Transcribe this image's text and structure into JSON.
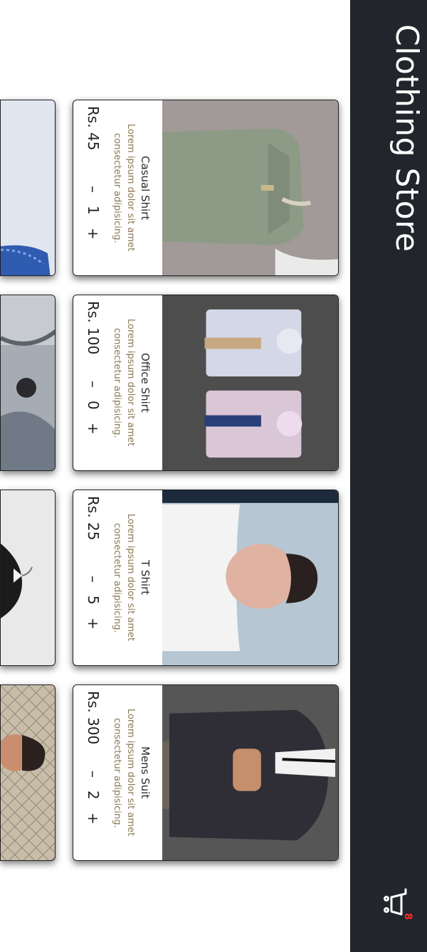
{
  "header": {
    "title": "Clothing Store",
    "cart_count": "8",
    "bg_color": "#22252b"
  },
  "products": [
    {
      "name": "Casual Shirt",
      "description": "Lorem ipsum dolor sit amet consectetur adipisicing.",
      "price": "Rs. 45",
      "quantity": "1",
      "minus": "–",
      "plus": "+"
    },
    {
      "name": "Office Shirt",
      "description": "Lorem ipsum dolor sit amet consectetur adipisicing.",
      "price": "Rs. 100",
      "quantity": "0",
      "minus": "–",
      "plus": "+"
    },
    {
      "name": "T Shirt",
      "description": "Lorem ipsum dolor sit amet consectetur adipisicing.",
      "price": "Rs. 25",
      "quantity": "5",
      "minus": "–",
      "plus": "+"
    },
    {
      "name": "Mens Suit",
      "description": "Lorem ipsum dolor sit amet consectetur adipisicing.",
      "price": "Rs. 300",
      "quantity": "2",
      "minus": "–",
      "plus": "+"
    }
  ]
}
